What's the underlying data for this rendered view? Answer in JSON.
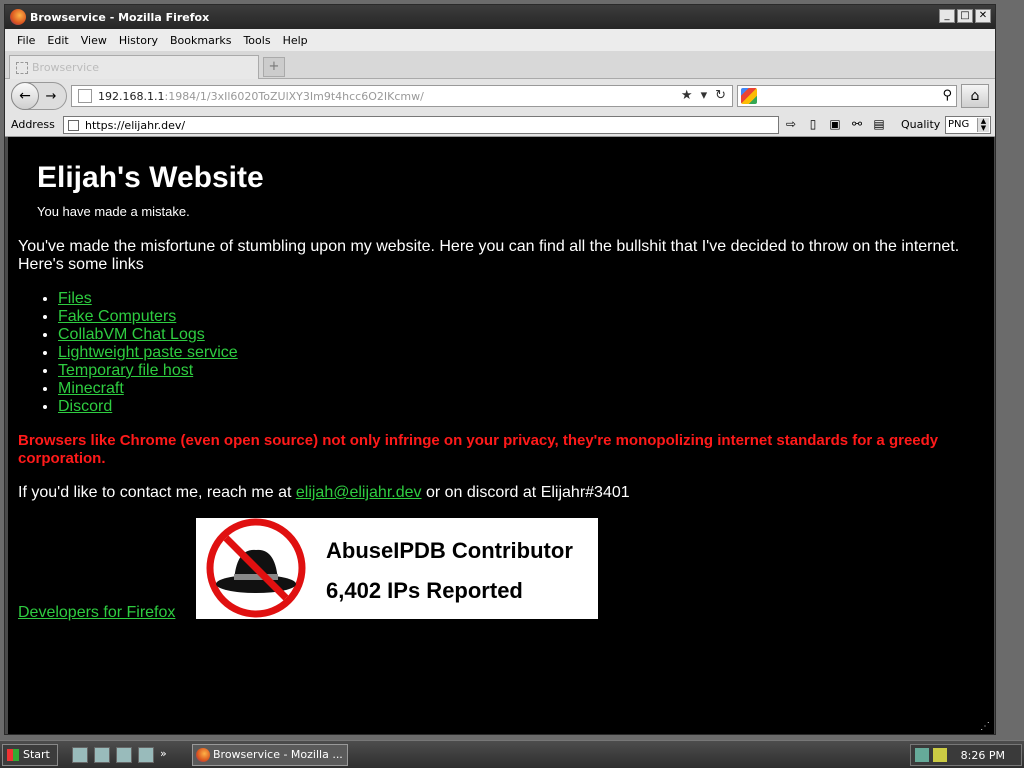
{
  "window": {
    "title": "Browservice - Mozilla Firefox",
    "controls": [
      "_",
      "□",
      "✕"
    ]
  },
  "menu": [
    "File",
    "Edit",
    "View",
    "History",
    "Bookmarks",
    "Tools",
    "Help"
  ],
  "tab": {
    "label": "Browservice"
  },
  "navbar": {
    "url_host": "192.168.1.1",
    "url_path": ":1984/1/3xIl6020ToZUlXY3Im9t4hcc6O2IKcmw/"
  },
  "addressbar": {
    "label": "Address",
    "value": "https://elijahr.dev/",
    "quality_label": "Quality",
    "quality_value": "PNG"
  },
  "page": {
    "title": "Elijah's Website",
    "subtitle": "You have made a mistake.",
    "intro": "You've made the misfortune of stumbling upon my website. Here you can find all the bullshit that I've decided to throw on the internet. Here's some links",
    "links": [
      "Files",
      "Fake Computers",
      "CollabVM Chat Logs",
      "Lightweight paste service",
      "Temporary file host",
      "Minecraft",
      "Discord"
    ],
    "warning": "Browsers like Chrome (even open source) not only infringe on your privacy, they're monopolizing internet standards for a greedy corporation.",
    "contact_prefix": "If you'd like to contact me, reach me at ",
    "contact_email": "elijah@elijahr.dev",
    "contact_suffix": " or on discord at Elijahr#3401",
    "dev_link": "Developers for Firefox",
    "abuse_title": "AbuseIPDB Contributor",
    "abuse_count": "6,402 IPs Reported"
  },
  "taskbar": {
    "start": "Start",
    "task": "Browservice - Mozilla ...",
    "clock": "8:26 PM"
  },
  "colors": {
    "link": "#2ecc40",
    "warning": "#ff1a1a",
    "page_bg": "#000000"
  }
}
